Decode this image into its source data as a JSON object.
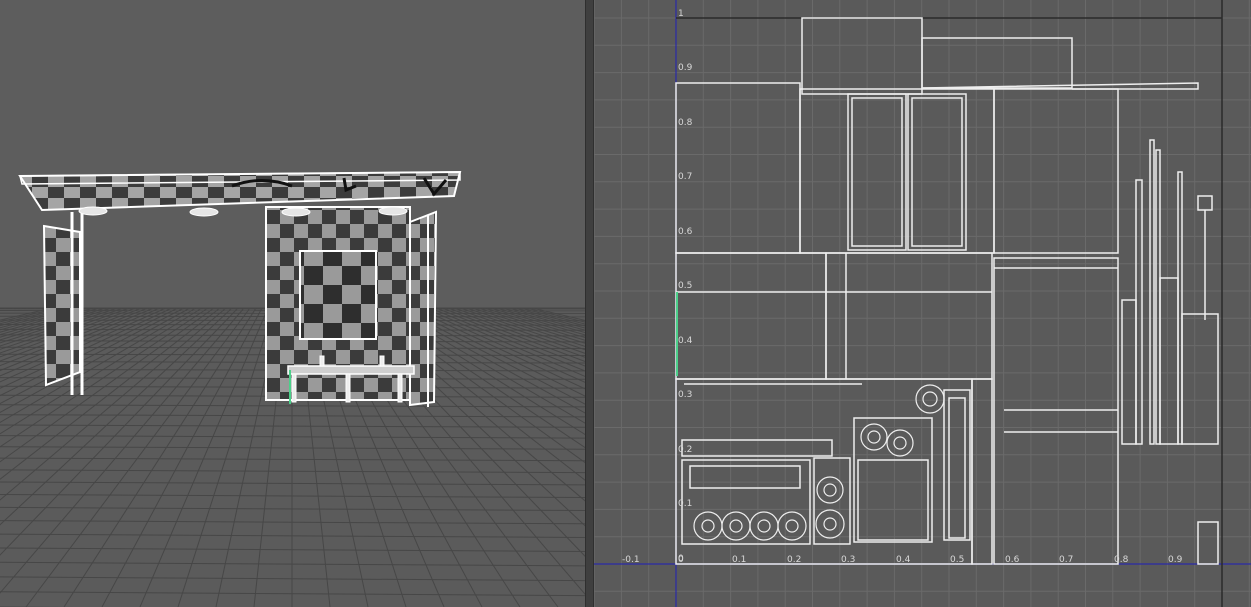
{
  "uv_editor": {
    "v_ticks": [
      "1",
      "0.9",
      "0.8",
      "0.7",
      "0.6",
      "0.5",
      "0.4",
      "0.3",
      "0.2",
      "0.1",
      "0"
    ],
    "u_ticks": [
      "-0.1",
      "0",
      "0.1",
      "0.2",
      "0.3",
      "0.4",
      "0.5",
      "0.6",
      "0.7",
      "0.8",
      "0.9"
    ]
  },
  "colors": {
    "background_3d": "#5d5d5d",
    "background_uv": "#5a5a5a",
    "wireframe": "#f2f2f2",
    "axis": "#2a2aa8",
    "selection": "#4cd08a"
  }
}
